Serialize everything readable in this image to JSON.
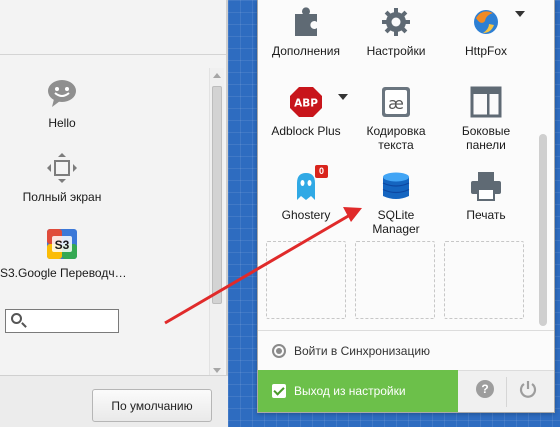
{
  "palette": {
    "items": [
      {
        "label": "Hello",
        "icon": "speech-bubble-icon"
      },
      {
        "label": "Полный экран",
        "icon": "fullscreen-icon"
      },
      {
        "label": "S3.Google Переводч…",
        "icon": "s3-translate-icon"
      }
    ],
    "search_value": "",
    "default_button": "По умолчанию"
  },
  "menu": {
    "rows": [
      [
        {
          "label": "Дополнения",
          "icon": "puzzle-icon"
        },
        {
          "label": "Настройки",
          "icon": "gear-icon"
        },
        {
          "label": "HttpFox",
          "icon": "httpfox-icon"
        }
      ],
      [
        {
          "label": "Adblock Plus",
          "icon": "abp-icon",
          "badge": "ABP"
        },
        {
          "label": "Кодировка текста",
          "icon": "encoding-icon",
          "glyph": "æ"
        },
        {
          "label": "Боковые панели",
          "icon": "sidebar-icon"
        }
      ],
      [
        {
          "label": "Ghostery",
          "icon": "ghostery-icon",
          "badge": "0"
        },
        {
          "label": "SQLite Manager",
          "icon": "sqlite-icon"
        },
        {
          "label": "Печать",
          "icon": "printer-icon"
        }
      ]
    ],
    "sync_label": "Войти в Синхронизацию",
    "exit_label": "Выход из настройки",
    "help_glyph": "?"
  },
  "colors": {
    "accent_green": "#6cc04a",
    "grid_blue": "#2e6cc0",
    "annotation_red": "#e02a2a"
  }
}
